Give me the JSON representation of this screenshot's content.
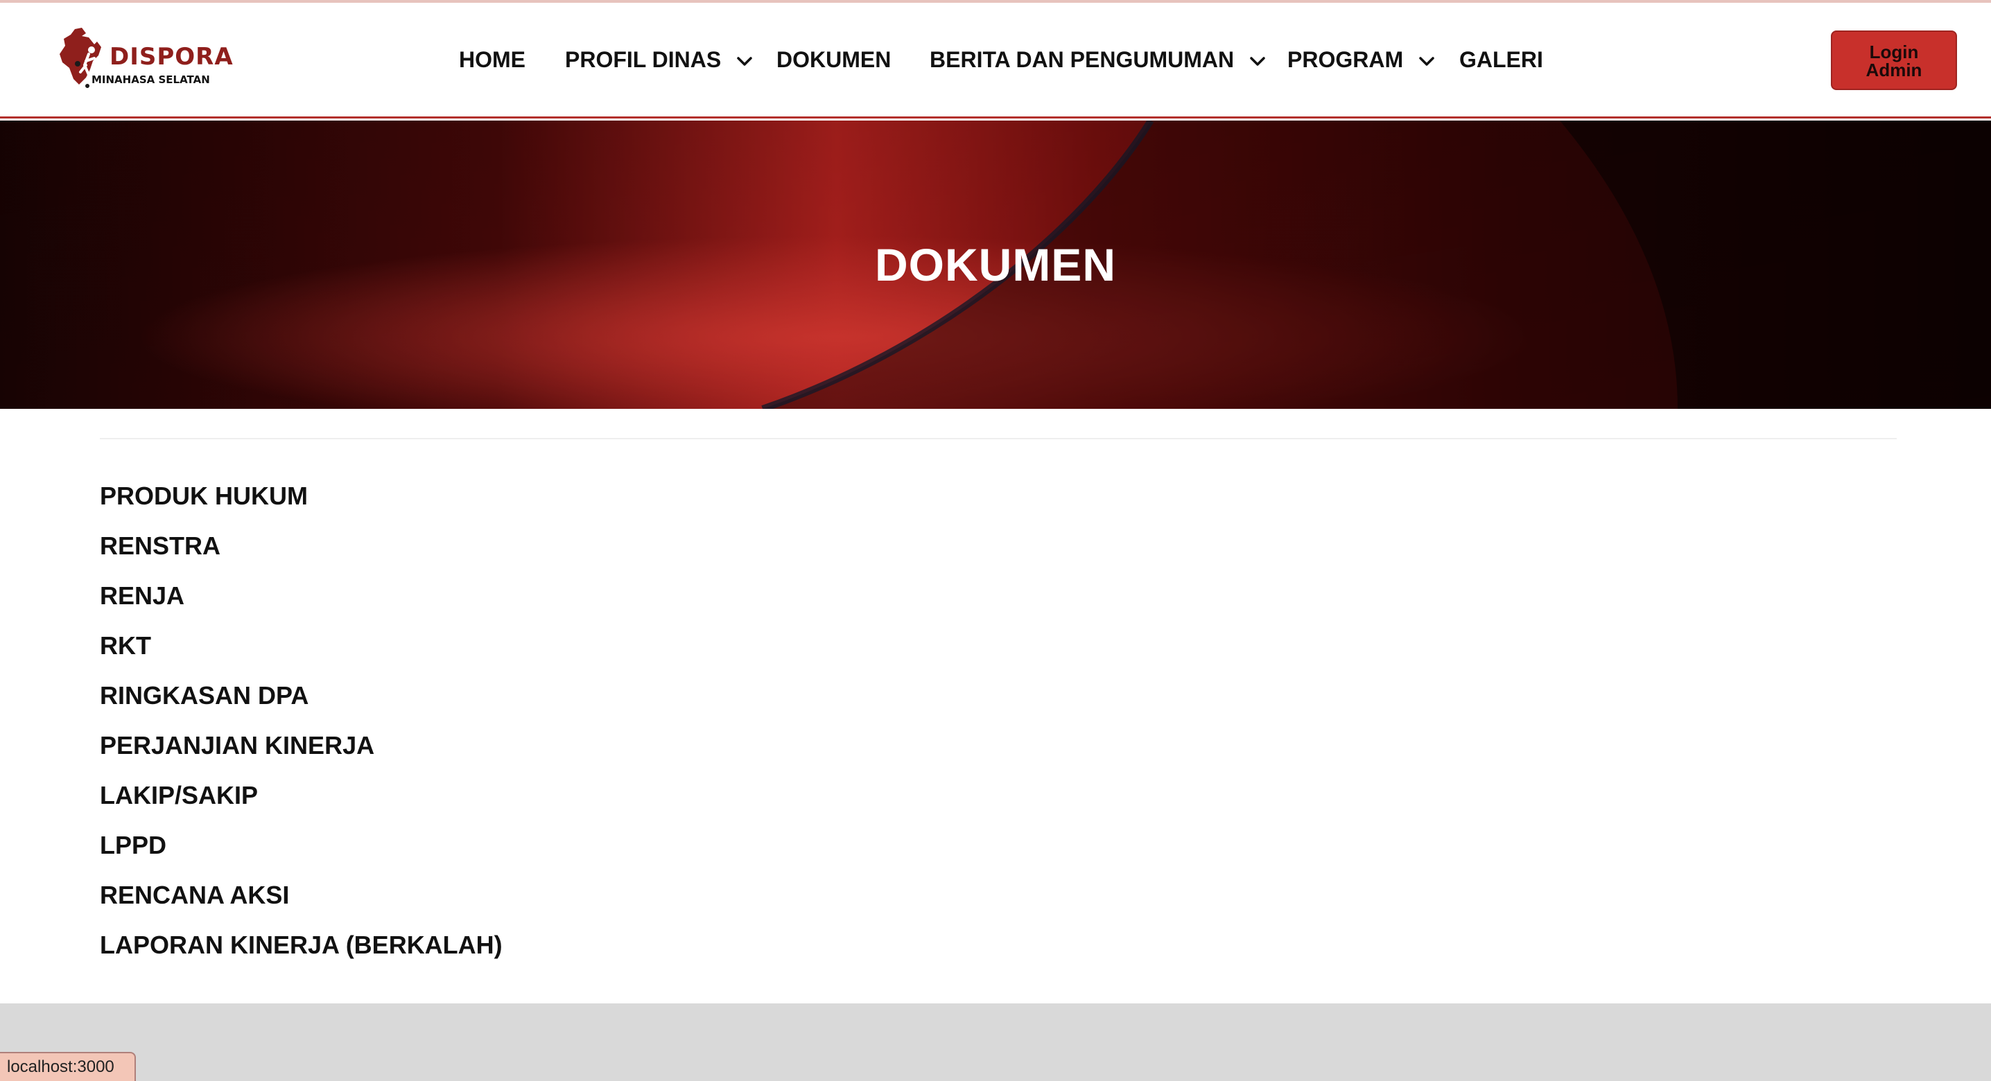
{
  "logo": {
    "name": "DISPORA",
    "subtitle": "MINAHASA SELATAN"
  },
  "nav": {
    "items": [
      {
        "label": "HOME",
        "has_dropdown": false
      },
      {
        "label": "PROFIL DINAS",
        "has_dropdown": true
      },
      {
        "label": "DOKUMEN",
        "has_dropdown": false
      },
      {
        "label": "BERITA DAN PENGUMUMAN",
        "has_dropdown": true
      },
      {
        "label": "PROGRAM",
        "has_dropdown": true
      },
      {
        "label": "GALERI",
        "has_dropdown": false
      }
    ],
    "login_line1": "Login",
    "login_line2": "Admin"
  },
  "hero": {
    "title": "DOKUMEN"
  },
  "documents": [
    "PRODUK HUKUM",
    "RENSTRA",
    "RENJA",
    "RKT",
    "RINGKASAN DPA",
    "PERJANJIAN KINERJA",
    "LAKIP/SAKIP",
    "LPPD",
    "RENCANA AKSI",
    "LAPORAN KINERJA (BERKALAH)"
  ],
  "status_bar": {
    "url": "localhost:3000"
  },
  "colors": {
    "accent": "#c8302b",
    "logo_red": "#8f1f1c",
    "footer": "#d9d9d9"
  },
  "icons": {
    "logo": "dispora-logo-icon",
    "dropdown": "chevron-down-icon"
  }
}
